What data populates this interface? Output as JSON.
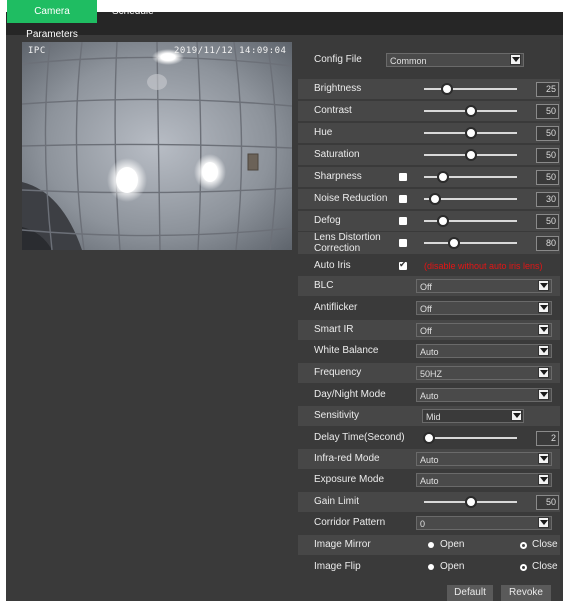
{
  "tabs": [
    {
      "label": "Camera Parameters"
    },
    {
      "label": "Schedule"
    }
  ],
  "video": {
    "osd_left": "IPC",
    "osd_time": "2019/11/12 14:09:04"
  },
  "config_file": {
    "label": "Config File",
    "value": "Common"
  },
  "sliders": {
    "brightness": {
      "label": "Brightness",
      "value": "25",
      "level": 25
    },
    "contrast": {
      "label": "Contrast",
      "value": "50",
      "level": 50
    },
    "hue": {
      "label": "Hue",
      "value": "50",
      "level": 50
    },
    "saturation": {
      "label": "Saturation",
      "value": "50",
      "level": 50
    },
    "sharpness": {
      "label": "Sharpness",
      "value": "50",
      "level": 20
    },
    "noise_reduction": {
      "label": "Noise Reduction",
      "value": "30",
      "level": 12
    },
    "defog": {
      "label": "Defog",
      "value": "50",
      "level": 20
    },
    "lens_distortion": {
      "label": "Lens Distortion Correction",
      "value": "80",
      "level": 32
    },
    "delay_time": {
      "label": "Delay Time(Second)",
      "value": "2",
      "level": 5
    },
    "gain_limit": {
      "label": "Gain Limit",
      "value": "50",
      "level": 50
    }
  },
  "auto_iris": {
    "label": "Auto Iris",
    "checked": true,
    "warning": "(disable without auto iris lens)"
  },
  "selects": {
    "blc": {
      "label": "BLC",
      "value": "Off"
    },
    "antiflicker": {
      "label": "Antiflicker",
      "value": "Off"
    },
    "smart_ir": {
      "label": "Smart IR",
      "value": "Off"
    },
    "white_balance": {
      "label": "White Balance",
      "value": "Auto"
    },
    "frequency": {
      "label": "Frequency",
      "value": "50HZ"
    },
    "day_night": {
      "label": "Day/Night Mode",
      "value": "Auto"
    },
    "sensitivity": {
      "label": "Sensitivity",
      "value": "Mid"
    },
    "infrared": {
      "label": "Infra-red Mode",
      "value": "Auto"
    },
    "exposure": {
      "label": "Exposure Mode",
      "value": "Auto"
    },
    "corridor": {
      "label": "Corridor Pattern",
      "value": "0"
    }
  },
  "image_mirror": {
    "label": "Image Mirror",
    "open": "Open",
    "close": "Close",
    "selected": "Open"
  },
  "image_flip": {
    "label": "Image Flip",
    "open": "Open",
    "close": "Close",
    "selected": "Open"
  },
  "buttons": {
    "default": "Default",
    "revoke": "Revoke"
  },
  "colors": {
    "accent": "#1fbd62",
    "warning": "#e31515",
    "panel": "#3a3a3a",
    "row": "#474747"
  }
}
